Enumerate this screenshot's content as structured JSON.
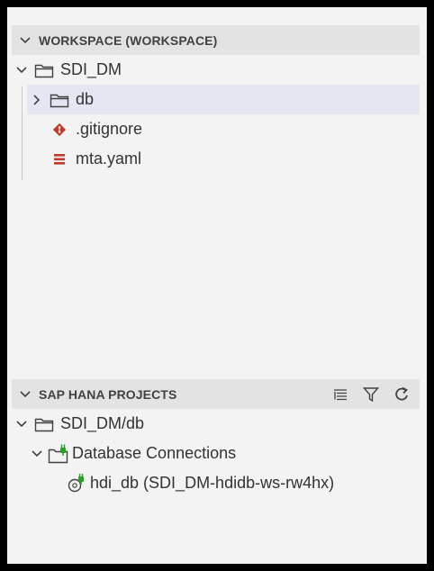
{
  "workspace": {
    "header": "WORKSPACE (WORKSPACE)",
    "root_folder": "SDI_DM",
    "items": [
      {
        "label": "db",
        "type": "folder",
        "icon": "folder-icon"
      },
      {
        "label": ".gitignore",
        "type": "file",
        "icon": "git-icon"
      },
      {
        "label": "mta.yaml",
        "type": "file",
        "icon": "yaml-file-icon"
      }
    ]
  },
  "hana": {
    "header": "SAP HANA PROJECTS",
    "actions": [
      "collapse-all-icon",
      "filter-icon",
      "refresh-icon"
    ],
    "project": "SDI_DM/db",
    "db_connections_label": "Database Connections",
    "connection": "hdi_db (SDI_DM-hdidb-ws-rw4hx)"
  },
  "colors": {
    "git_icon": "#c0392b",
    "yaml_icon": "#c0392b",
    "plug_green": "#2ca02c",
    "selected_row": "#e4e6f1",
    "header_bg": "#e3e3e3"
  }
}
